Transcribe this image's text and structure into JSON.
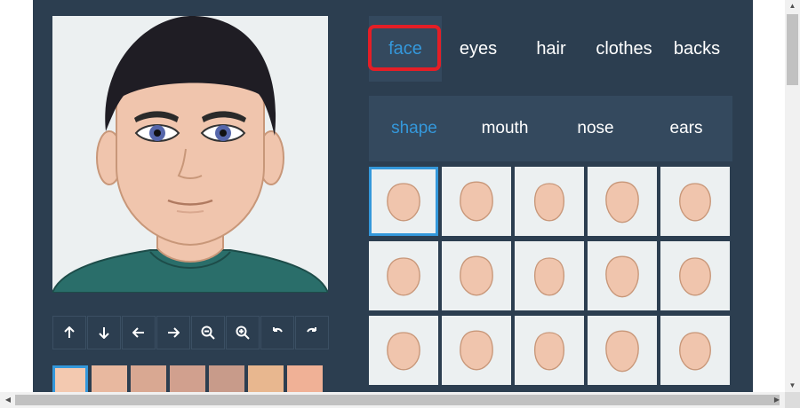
{
  "categories": [
    "face",
    "eyes",
    "hair",
    "clothes",
    "backs"
  ],
  "active_category": "face",
  "subcategories": [
    "shape",
    "mouth",
    "nose",
    "ears"
  ],
  "active_subcategory": "shape",
  "controls": [
    "arrow-up-icon",
    "arrow-down-icon",
    "arrow-left-icon",
    "arrow-right-icon",
    "zoom-out-icon",
    "zoom-in-icon",
    "rotate-left-icon",
    "rotate-right-icon"
  ],
  "skin_swatches": [
    "#f3c9b0",
    "#e8b89f",
    "#d9a892",
    "#d1a08e",
    "#c89b8a",
    "#e8b78f",
    "#f0b196"
  ],
  "selected_swatch": 0,
  "face_shape_selected": 0,
  "colors": {
    "panel": "#2c3e50",
    "accent": "#3498db",
    "highlight": "#e41e26",
    "skin": "#f0c5ad"
  }
}
